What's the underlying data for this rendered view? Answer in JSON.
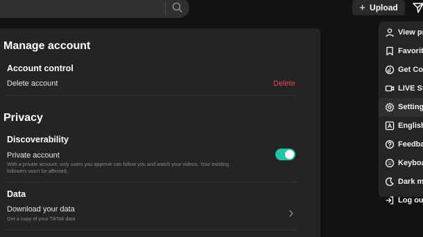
{
  "header": {
    "search": {
      "icon": "search-icon"
    },
    "upload_label": "Upload",
    "upload_icon": "plus-icon",
    "inbox_icon": "send-icon"
  },
  "settings": {
    "manage_account": {
      "title": "Manage account",
      "account_control": {
        "heading": "Account control",
        "delete_row_label": "Delete account",
        "delete_action": "Delete",
        "delete_color": "#e3435a"
      }
    },
    "privacy": {
      "title": "Privacy",
      "discoverability": {
        "heading": "Discoverability",
        "private_account_label": "Private account",
        "private_account_desc_line1": "With a private account, only users you approve can follow you and watch your videos. Your existing",
        "private_account_desc_line2": "followers won't be affected.",
        "private_account_enabled": true,
        "toggle_color": "#21c5a5"
      },
      "data": {
        "heading": "Data",
        "download_label": "Download your data",
        "download_desc": "Get a copy of your TikTok data"
      }
    }
  },
  "menu": {
    "items": [
      {
        "label": "View pr",
        "icon": "person-icon"
      },
      {
        "label": "Favorite",
        "icon": "bookmark-icon"
      },
      {
        "label": "Get Coi",
        "icon": "coin-icon"
      },
      {
        "label": "LIVE St",
        "icon": "live-camera-icon"
      },
      {
        "label": "Setting",
        "icon": "gear-icon",
        "active": true
      },
      {
        "label": "English",
        "icon": "language-icon"
      },
      {
        "label": "Feedba",
        "icon": "help-icon"
      },
      {
        "label": "Keyboa",
        "icon": "keyboard-icon"
      },
      {
        "label": "Dark mo",
        "icon": "moon-icon"
      },
      {
        "label": "Log out",
        "icon": "logout-icon"
      }
    ]
  }
}
